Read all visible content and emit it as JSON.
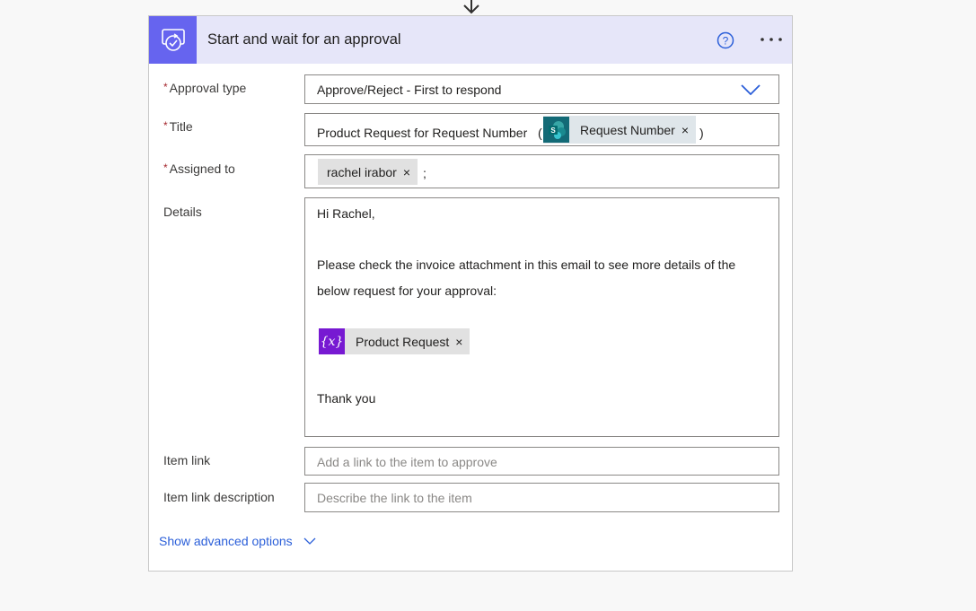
{
  "flow": {
    "connector_arrow_icon": "arrow-down-icon"
  },
  "card": {
    "title": "Start and wait for an approval",
    "header_icon": "approval-check-icon",
    "accent_color": "#6664ef",
    "header_bg": "#e6e6f9",
    "help_icon": "help-circle-icon",
    "more_icon": "more-ellipsis-icon"
  },
  "fields": {
    "approval_type": {
      "label": "Approval type",
      "required_mark": "*",
      "value": "Approve/Reject - First to respond"
    },
    "title": {
      "label": "Title",
      "required_mark": "*",
      "prefix": "Product Request for Request Number",
      "open_paren": "(",
      "token": {
        "label": "Request Number",
        "icon": "sharepoint-icon",
        "remove": "×"
      },
      "close_paren": ")"
    },
    "assigned_to": {
      "label": "Assigned to",
      "required_mark": "*",
      "token": {
        "label": "rachel irabor",
        "remove": "×"
      },
      "separator": ";"
    },
    "details": {
      "label": "Details",
      "lines": [
        "Hi Rachel,",
        "Please check the invoice attachment in this email to see more details of the",
        "below request for your approval:",
        "Thank you"
      ],
      "token": {
        "label": "Product Request",
        "icon": "variable-icon",
        "icon_text": "{x}",
        "remove": "×"
      }
    },
    "item_link": {
      "label": "Item link",
      "placeholder": "Add a link to the item to approve"
    },
    "item_link_description": {
      "label": "Item link description",
      "placeholder": "Describe the link to the item"
    }
  },
  "advanced": {
    "label": "Show advanced options"
  }
}
